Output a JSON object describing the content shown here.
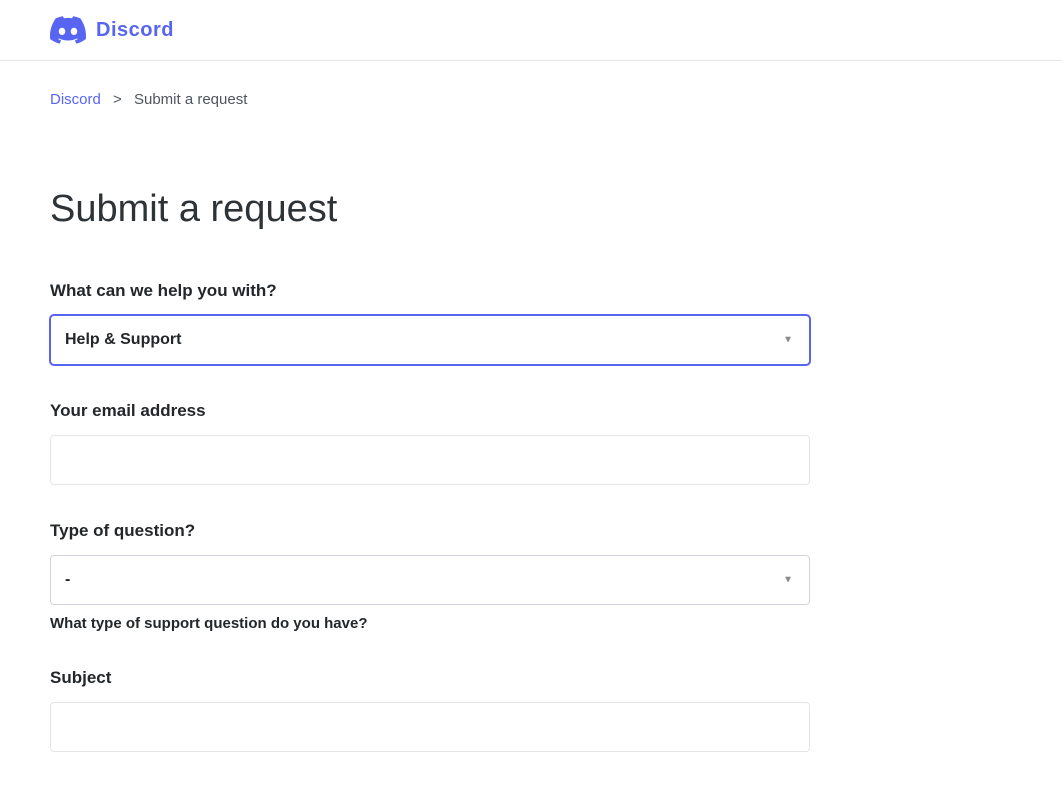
{
  "header": {
    "brand_name": "Discord"
  },
  "breadcrumb": {
    "home_label": "Discord",
    "current_label": "Submit a request"
  },
  "page": {
    "title": "Submit a request"
  },
  "form": {
    "help_with": {
      "label": "What can we help you with?",
      "selected_value": "Help & Support"
    },
    "email": {
      "label": "Your email address",
      "value": ""
    },
    "question_type": {
      "label": "Type of question?",
      "selected_value": "-",
      "hint": "What type of support question do you have?"
    },
    "subject": {
      "label": "Subject",
      "value": ""
    }
  }
}
